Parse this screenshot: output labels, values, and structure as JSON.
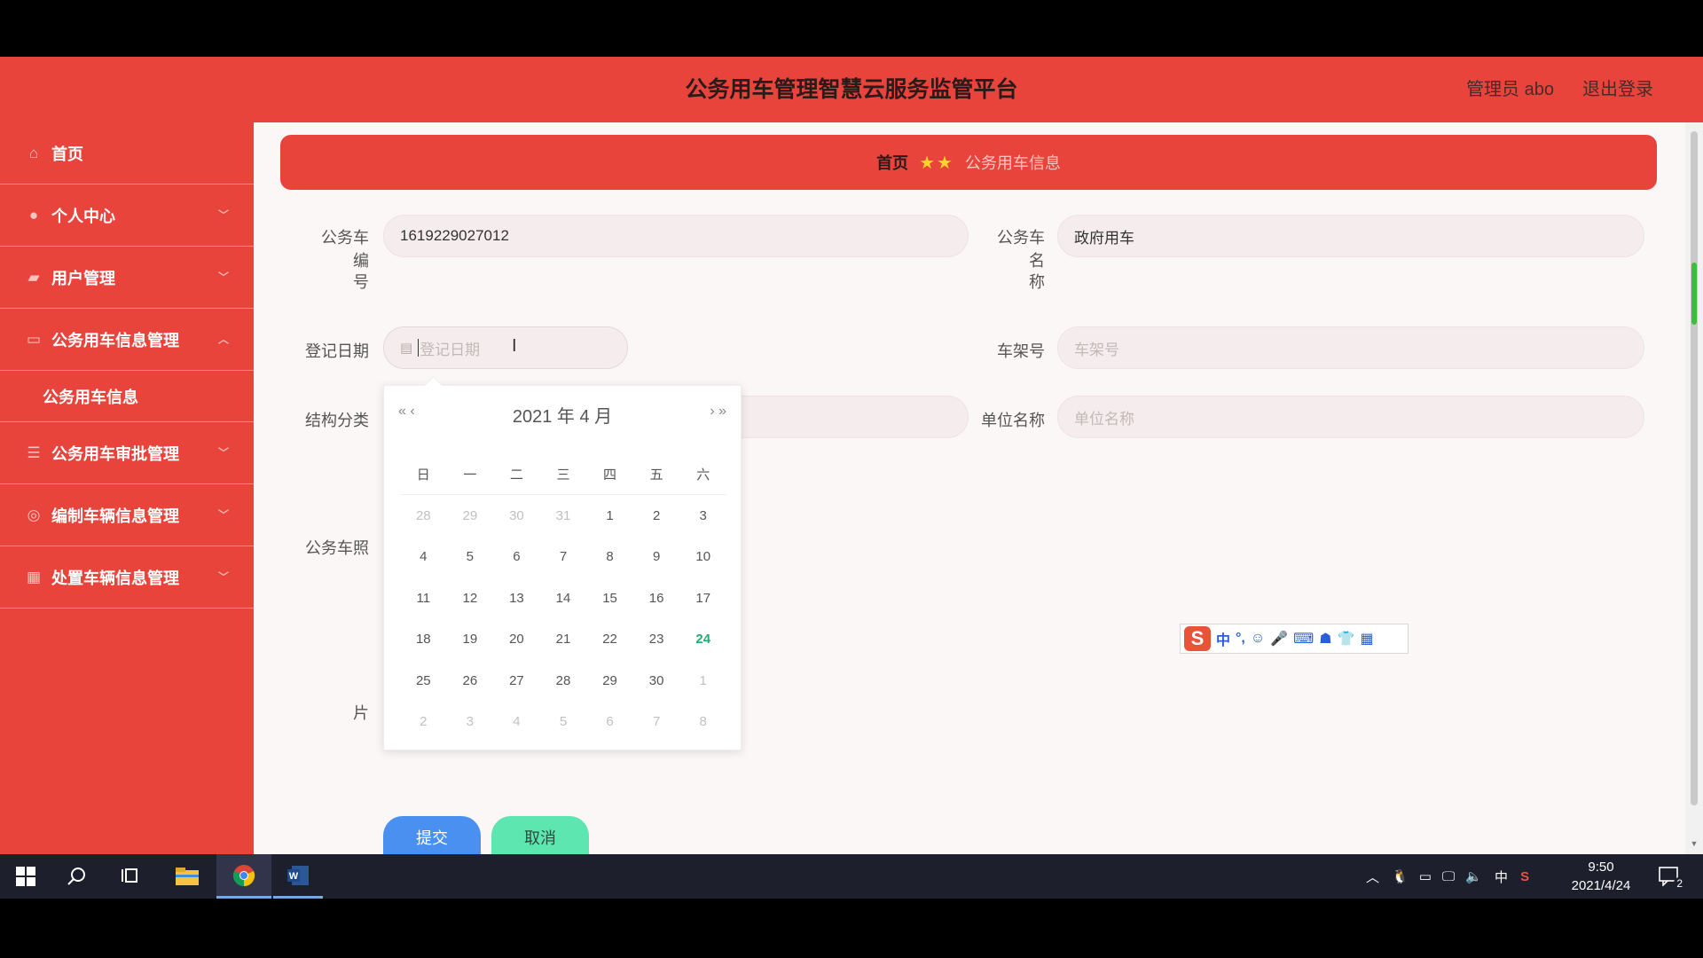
{
  "header": {
    "title": "公务用车管理智慧云服务监管平台",
    "admin_label": "管理员 abo",
    "logout_label": "退出登录"
  },
  "sidebar": {
    "items": [
      {
        "label": "首页",
        "icon": "home-icon"
      },
      {
        "label": "个人中心",
        "icon": "user-icon"
      },
      {
        "label": "用户管理",
        "icon": "users-icon"
      },
      {
        "label": "公务用车信息管理",
        "icon": "card-icon"
      },
      {
        "label": "公务用车审批管理",
        "icon": "list-icon"
      },
      {
        "label": "编制车辆信息管理",
        "icon": "compass-icon"
      },
      {
        "label": "处置车辆信息管理",
        "icon": "grid-icon"
      }
    ],
    "sub_item": "公务用车信息"
  },
  "breadcrumb": {
    "home": "首页",
    "stars": "★★",
    "current": "公务用车信息"
  },
  "form": {
    "car_no_label_1": "公务车编",
    "car_no_label_2": "号",
    "car_no_value": "1619229027012",
    "car_name_label_1": "公务车名",
    "car_name_label_2": "称",
    "car_name_value": "政府用车",
    "reg_date_label": "登记日期",
    "reg_date_placeholder": "登记日期",
    "frame_no_label": "车架号",
    "frame_no_placeholder": "车架号",
    "structure_label": "结构分类",
    "unit_name_label": "单位名称",
    "unit_name_placeholder": "单位名称",
    "photo_label_1": "公务车照",
    "photo_label_2": "片",
    "submit": "提交",
    "cancel": "取消"
  },
  "datepicker": {
    "prev": "« ‹",
    "next": "› »",
    "title": "2021 年  4 月",
    "weekdays": [
      "日",
      "一",
      "二",
      "三",
      "四",
      "五",
      "六"
    ],
    "weeks": [
      [
        "28",
        "29",
        "30",
        "31",
        "1",
        "2",
        "3"
      ],
      [
        "4",
        "5",
        "6",
        "7",
        "8",
        "9",
        "10"
      ],
      [
        "11",
        "12",
        "13",
        "14",
        "15",
        "16",
        "17"
      ],
      [
        "18",
        "19",
        "20",
        "21",
        "22",
        "23",
        "24"
      ],
      [
        "25",
        "26",
        "27",
        "28",
        "29",
        "30",
        "1"
      ],
      [
        "2",
        "3",
        "4",
        "5",
        "6",
        "7",
        "8"
      ]
    ],
    "today": "24"
  },
  "ime": {
    "logo": "S",
    "mode": "中",
    "punct": "°,"
  },
  "taskbar": {
    "tray_lang": "中",
    "time": "9:50",
    "date": "2021/4/24",
    "notifications": "2"
  },
  "colors": {
    "brand_red": "#e8443c",
    "today_green": "#1fae70",
    "submit_blue": "#4a90f0",
    "cancel_green": "#5ee6b0"
  }
}
